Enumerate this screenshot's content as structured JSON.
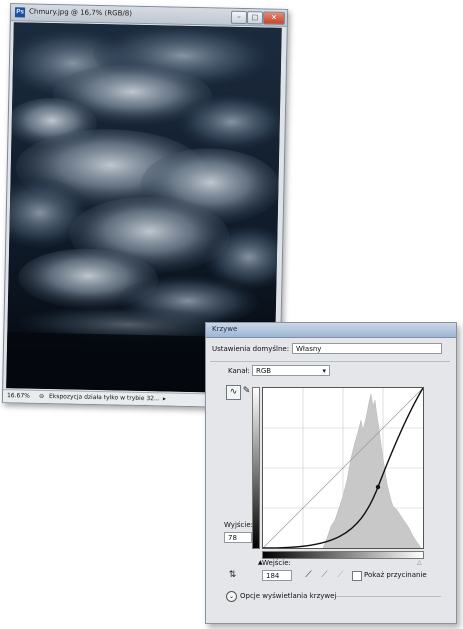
{
  "document_window": {
    "title": "Chmury.jpg @ 16,7% (RGB/8)",
    "app_icon": "Ps",
    "buttons": {
      "minimize": "minimize-icon",
      "maximize": "maximize-icon",
      "close": "close-icon"
    },
    "status": {
      "zoom": "16.67%",
      "message": "Ekspozycja działa tylko w trybie 32..."
    }
  },
  "curves_dialog": {
    "title": "Krzywe",
    "preset_label": "Ustawienia domyślne:",
    "preset_value": "Własny",
    "channel_label": "Kanał:",
    "channel_value": "RGB",
    "output_label": "Wyjście:",
    "output_value": "78",
    "input_label": "Wejście:",
    "input_value": "184",
    "show_clipping_label": "Pokaż przycinanie",
    "curve_display_label": "Opcje wyświetlania krzywej",
    "tools": [
      "curve-edit-icon",
      "pencil-icon"
    ],
    "eyedroppers": [
      "black-eyedropper-icon",
      "gray-eyedropper-icon",
      "white-eyedropper-icon"
    ],
    "curve_point": {
      "input": 184,
      "output": 78
    }
  }
}
